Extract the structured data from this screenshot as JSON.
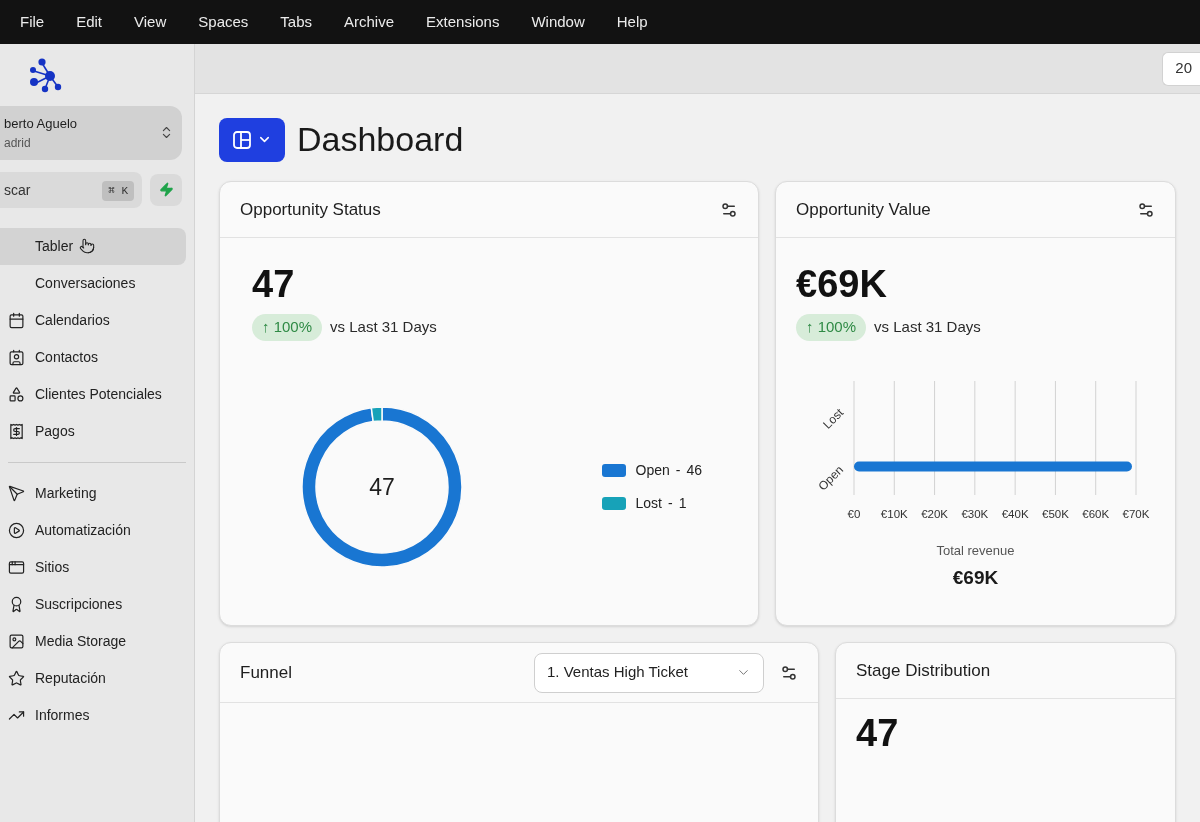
{
  "menu_bar": {
    "items": [
      "File",
      "Edit",
      "View",
      "Spaces",
      "Tabs",
      "Archive",
      "Extensions",
      "Window",
      "Help"
    ]
  },
  "toolbar": {
    "chip": "20"
  },
  "sidebar": {
    "account": {
      "name": "berto Aguelo",
      "location": "adrid"
    },
    "search": {
      "placeholder": "scar",
      "shortcut": "⌘ K"
    },
    "items": [
      {
        "label": "Tabler",
        "selected": true
      },
      {
        "label": "Conversaciones",
        "selected": false
      },
      {
        "label": "Calendarios",
        "selected": false
      },
      {
        "label": "Contactos",
        "selected": false
      },
      {
        "label": "Clientes Potenciales",
        "selected": false
      },
      {
        "label": "Pagos",
        "selected": false
      }
    ],
    "tools": [
      {
        "label": "Marketing",
        "selected": false
      },
      {
        "label": "Automatización",
        "selected": false
      },
      {
        "label": "Sitios",
        "selected": false
      },
      {
        "label": "Suscripciones",
        "selected": false
      },
      {
        "label": "Media Storage",
        "selected": false
      },
      {
        "label": "Reputación",
        "selected": false
      },
      {
        "label": "Informes",
        "selected": false
      }
    ]
  },
  "page": {
    "title": "Dashboard"
  },
  "opportunity_status": {
    "title": "Opportunity Status",
    "value": "47",
    "badge": "↑ 100%",
    "comparison": "vs Last 31 Days",
    "center_label": "47",
    "legend": [
      {
        "separator": "-",
        "count": "46",
        "color": "#1976d2"
      },
      {
        "separator": "-",
        "count": "1",
        "color": "#17a2b8"
      }
    ],
    "chart_data": {
      "type": "donut",
      "categories": [
        "Open",
        "Lost"
      ],
      "values": [
        97.87,
        2.13
      ],
      "legend": "right"
    }
  },
  "opportunity_value": {
    "title": "Opportunity Value",
    "value": "€69K",
    "badge": "↑ 100%",
    "comparison": "vs Last 31 Days",
    "chart_data": {
      "type": "bar",
      "orientation": "horizontal",
      "grid": true,
      "categories": [
        "Lost",
        "Open"
      ],
      "values": [
        0,
        69000
      ],
      "xlim": [
        0,
        70000
      ],
      "xticks": [
        {
          "value": 0,
          "label": "€0"
        },
        {
          "value": 10000,
          "label": "€10K"
        },
        {
          "value": 20000,
          "label": "€20K"
        },
        {
          "value": 30000,
          "label": "€30K"
        },
        {
          "value": 40000,
          "label": "€40K"
        },
        {
          "value": 50000,
          "label": "€50K"
        },
        {
          "value": 60000,
          "label": "€60K"
        },
        {
          "value": 70000,
          "label": "€70K"
        }
      ]
    },
    "total_label": "Total revenue",
    "total_value": "€69K"
  },
  "funnel": {
    "title": "Funnel",
    "pipeline": "1. Ventas High Ticket"
  },
  "stage_distribution": {
    "title": "Stage Distribution",
    "value": "47"
  }
}
